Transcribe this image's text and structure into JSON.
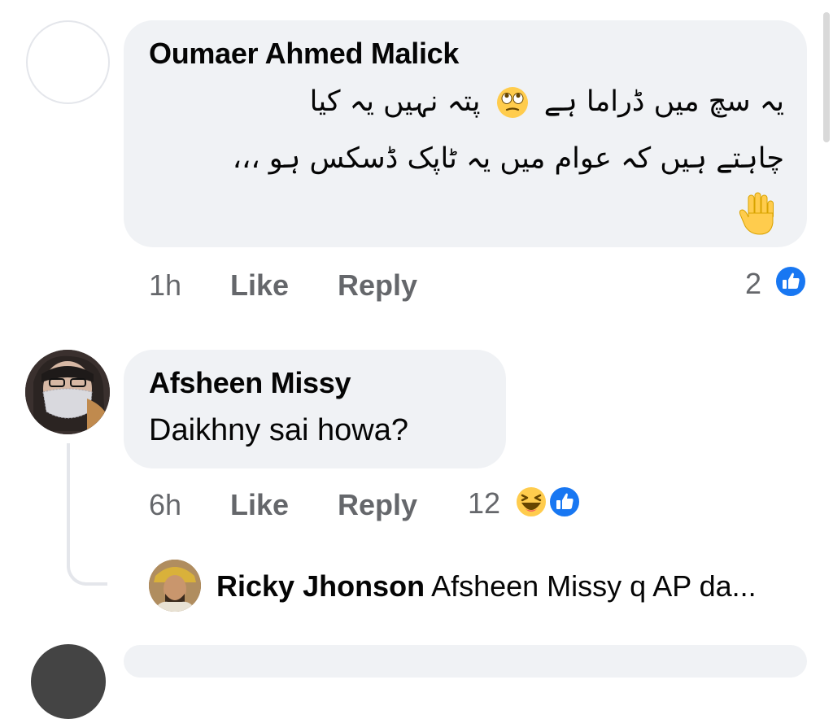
{
  "comments": [
    {
      "author": "Oumaer Ahmed Malick",
      "line_1_start": "یہ سچ میں ڈراما ہے",
      "line_1_emoji": "face-with-rolling-eyes-icon",
      "line_1_end": "پتہ نہیں یہ کیا",
      "line_2": "چاہتے ہیں کہ عوام میں یہ ٹاپک ڈسکس ہو ،،،",
      "trailing_emoji": "raised-hand-icon",
      "time": "1h",
      "like_label": "Like",
      "reply_label": "Reply",
      "reaction_count": "2",
      "reactions": [
        "like-icon"
      ]
    },
    {
      "author": "Afsheen Missy",
      "text": "Daikhny sai howa?",
      "time": "6h",
      "like_label": "Like",
      "reply_label": "Reply",
      "reaction_count": "12",
      "reactions": [
        "haha-icon",
        "like-icon"
      ]
    }
  ],
  "reply_preview": {
    "author": "Ricky Jhonson",
    "text": "Afsheen Missy q AP da..."
  },
  "colors": {
    "bubble": "#f0f2f5",
    "meta_text": "#65676b",
    "like_blue": "#1877f2",
    "emoji_yellow": "#ffcc4d"
  }
}
